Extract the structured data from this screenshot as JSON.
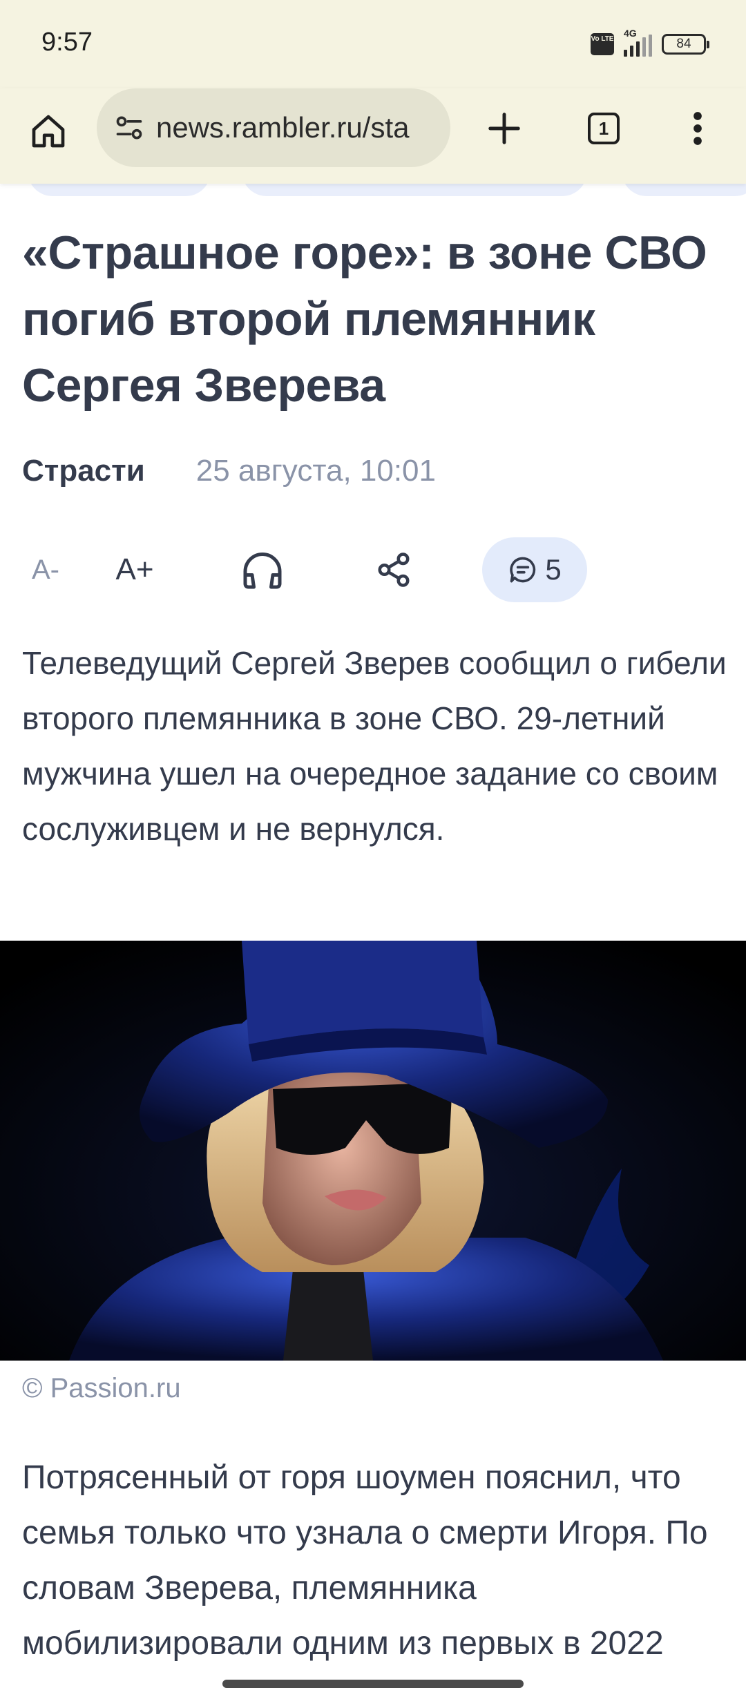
{
  "status_bar": {
    "time": "9:57",
    "volte": "Vo LTE",
    "network": "4G",
    "battery": "84"
  },
  "browser": {
    "url": "news.rambler.ru/sta",
    "tab_count": "1",
    "icons": {
      "home": "home-icon",
      "site_settings": "site-settings-icon",
      "new_tab": "plus-icon",
      "tabs": "tabs-icon",
      "menu": "more-vert-icon"
    }
  },
  "article": {
    "title": "«Страшное горе»: в зоне СВО погиб второй племянник Сергея Зверева",
    "rubric": "Страсти",
    "date": "25 августа, 10:01",
    "actions": {
      "font_decrease": "A-",
      "font_increase": "A+",
      "listen": "headphones-icon",
      "share": "share-icon",
      "comments_icon": "comment-icon",
      "comments_count": "5"
    },
    "lead": "Телеведущий Сергей Зверев сообщил о гибели второго племянника в зоне СВО. 29-летний мужчина ушел на очередное задание со своим сослуживцем и не вернулся.",
    "photo_caption": "© Passion.ru",
    "body_text": "Потрясенный от горя шоумен пояснил, что семья только что узнала о смерти Игоря. По словам Зверева, племянника мобилизировали одним из первых в 2022"
  },
  "colors": {
    "chrome_bg": "#f5f3e1",
    "url_pill": "#e4e3d1",
    "text_primary": "#343b4c",
    "text_muted": "#8a93a8",
    "comments_pill": "#e3ebfb"
  }
}
